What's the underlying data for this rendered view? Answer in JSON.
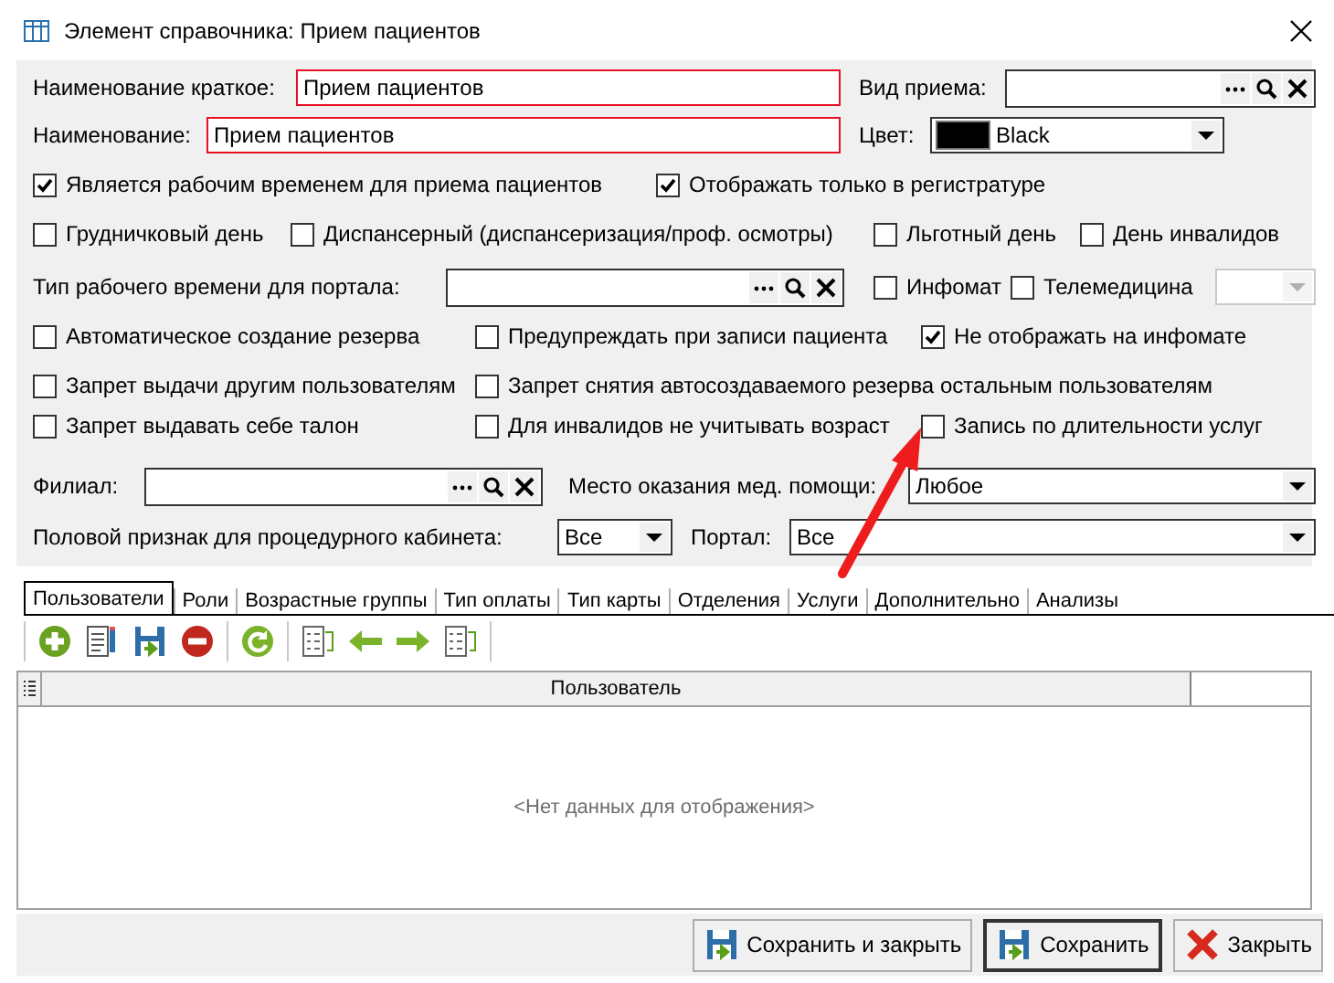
{
  "window": {
    "title": "Элемент справочника: Прием пациентов"
  },
  "form_rows": [
    {
      "items": [
        {
          "kind": "label",
          "text": "Наименование краткое:"
        },
        {
          "kind": "text_field",
          "value": "Прием пациентов",
          "required": true
        },
        {
          "kind": "label",
          "text": "Вид приема:"
        },
        {
          "kind": "lookup"
        }
      ]
    },
    {
      "items": [
        {
          "kind": "label",
          "text": "Наименование:"
        },
        {
          "kind": "text_field",
          "value": "Прием пациентов",
          "required": true
        },
        {
          "kind": "label",
          "text": "Цвет:"
        },
        {
          "kind": "color_combo",
          "value": "Black",
          "color": "#000000"
        }
      ]
    },
    {
      "items": [
        {
          "kind": "checkbox",
          "label": "Является рабочим временем для приема пациентов",
          "checked": true
        },
        {
          "kind": "checkbox",
          "label": "Отображать только в регистратуре",
          "checked": true
        }
      ]
    },
    {
      "items": [
        {
          "kind": "checkbox",
          "label": "Грудничковый день",
          "checked": false
        },
        {
          "kind": "checkbox",
          "label": "Диспансерный (диспансеризация/проф. осмотры)",
          "checked": false
        },
        {
          "kind": "checkbox",
          "label": "Льготный день",
          "checked": false
        },
        {
          "kind": "checkbox",
          "label": "День инвалидов",
          "checked": false
        }
      ]
    },
    {
      "items": [
        {
          "kind": "label",
          "text": "Тип рабочего времени для портала:"
        },
        {
          "kind": "lookup"
        },
        {
          "kind": "checkbox",
          "label": "Инфомат",
          "checked": false
        },
        {
          "kind": "checkbox",
          "label": "Телемедицина",
          "checked": false
        },
        {
          "kind": "combo",
          "disabled": true
        }
      ]
    },
    {
      "items": [
        {
          "kind": "checkbox",
          "label": "Автоматическое создание резерва",
          "checked": false
        },
        {
          "kind": "checkbox",
          "label": "Предупреждать при записи пациента",
          "checked": false
        },
        {
          "kind": "checkbox",
          "label": "Не отображать на инфомате",
          "checked": true
        }
      ]
    },
    {
      "items": [
        {
          "kind": "checkbox",
          "label": "Запрет выдачи другим пользователям",
          "checked": false
        },
        {
          "kind": "checkbox",
          "label": "Запрет снятия автосоздаваемого резерва остальным пользователям",
          "checked": false
        }
      ]
    },
    {
      "items": [
        {
          "kind": "checkbox",
          "label": "Запрет выдавать себе талон",
          "checked": false
        },
        {
          "kind": "checkbox",
          "label": "Для инвалидов не учитывать возраст",
          "checked": false
        },
        {
          "kind": "checkbox",
          "label": "Запись по длительности услуг",
          "checked": false
        }
      ]
    },
    {
      "items": [
        {
          "kind": "label",
          "text": "Филиал:"
        },
        {
          "kind": "lookup"
        },
        {
          "kind": "label",
          "text": "Место оказания мед. помощи:"
        },
        {
          "kind": "combo",
          "value": "Любое",
          "disabled": false
        }
      ]
    },
    {
      "items": [
        {
          "kind": "label",
          "text": "Половой признак для процедурного кабинета:"
        },
        {
          "kind": "combo",
          "value": "Все",
          "disabled": false
        },
        {
          "kind": "label",
          "text": "Портал:"
        },
        {
          "kind": "combo",
          "value": "Все",
          "disabled": false
        }
      ]
    }
  ],
  "tabs": [
    {
      "label": "Пользователи",
      "selected": true
    },
    {
      "label": "Роли",
      "selected": false
    },
    {
      "label": "Возрастные группы",
      "selected": false
    },
    {
      "label": "Тип оплаты",
      "selected": false
    },
    {
      "label": "Тип карты",
      "selected": false
    },
    {
      "label": "Отделения",
      "selected": false
    },
    {
      "label": "Услуги",
      "selected": false
    },
    {
      "label": "Дополнительно",
      "selected": false
    },
    {
      "label": "Анализы",
      "selected": false
    }
  ],
  "grid": {
    "columns": [
      "Пользователь"
    ],
    "empty_text": "<Нет данных для отображения>"
  },
  "buttons": [
    {
      "label": "Сохранить и закрыть",
      "kind": "save",
      "default": false
    },
    {
      "label": "Сохранить",
      "kind": "save",
      "default": true
    },
    {
      "label": "Закрыть",
      "kind": "close",
      "default": false
    }
  ]
}
